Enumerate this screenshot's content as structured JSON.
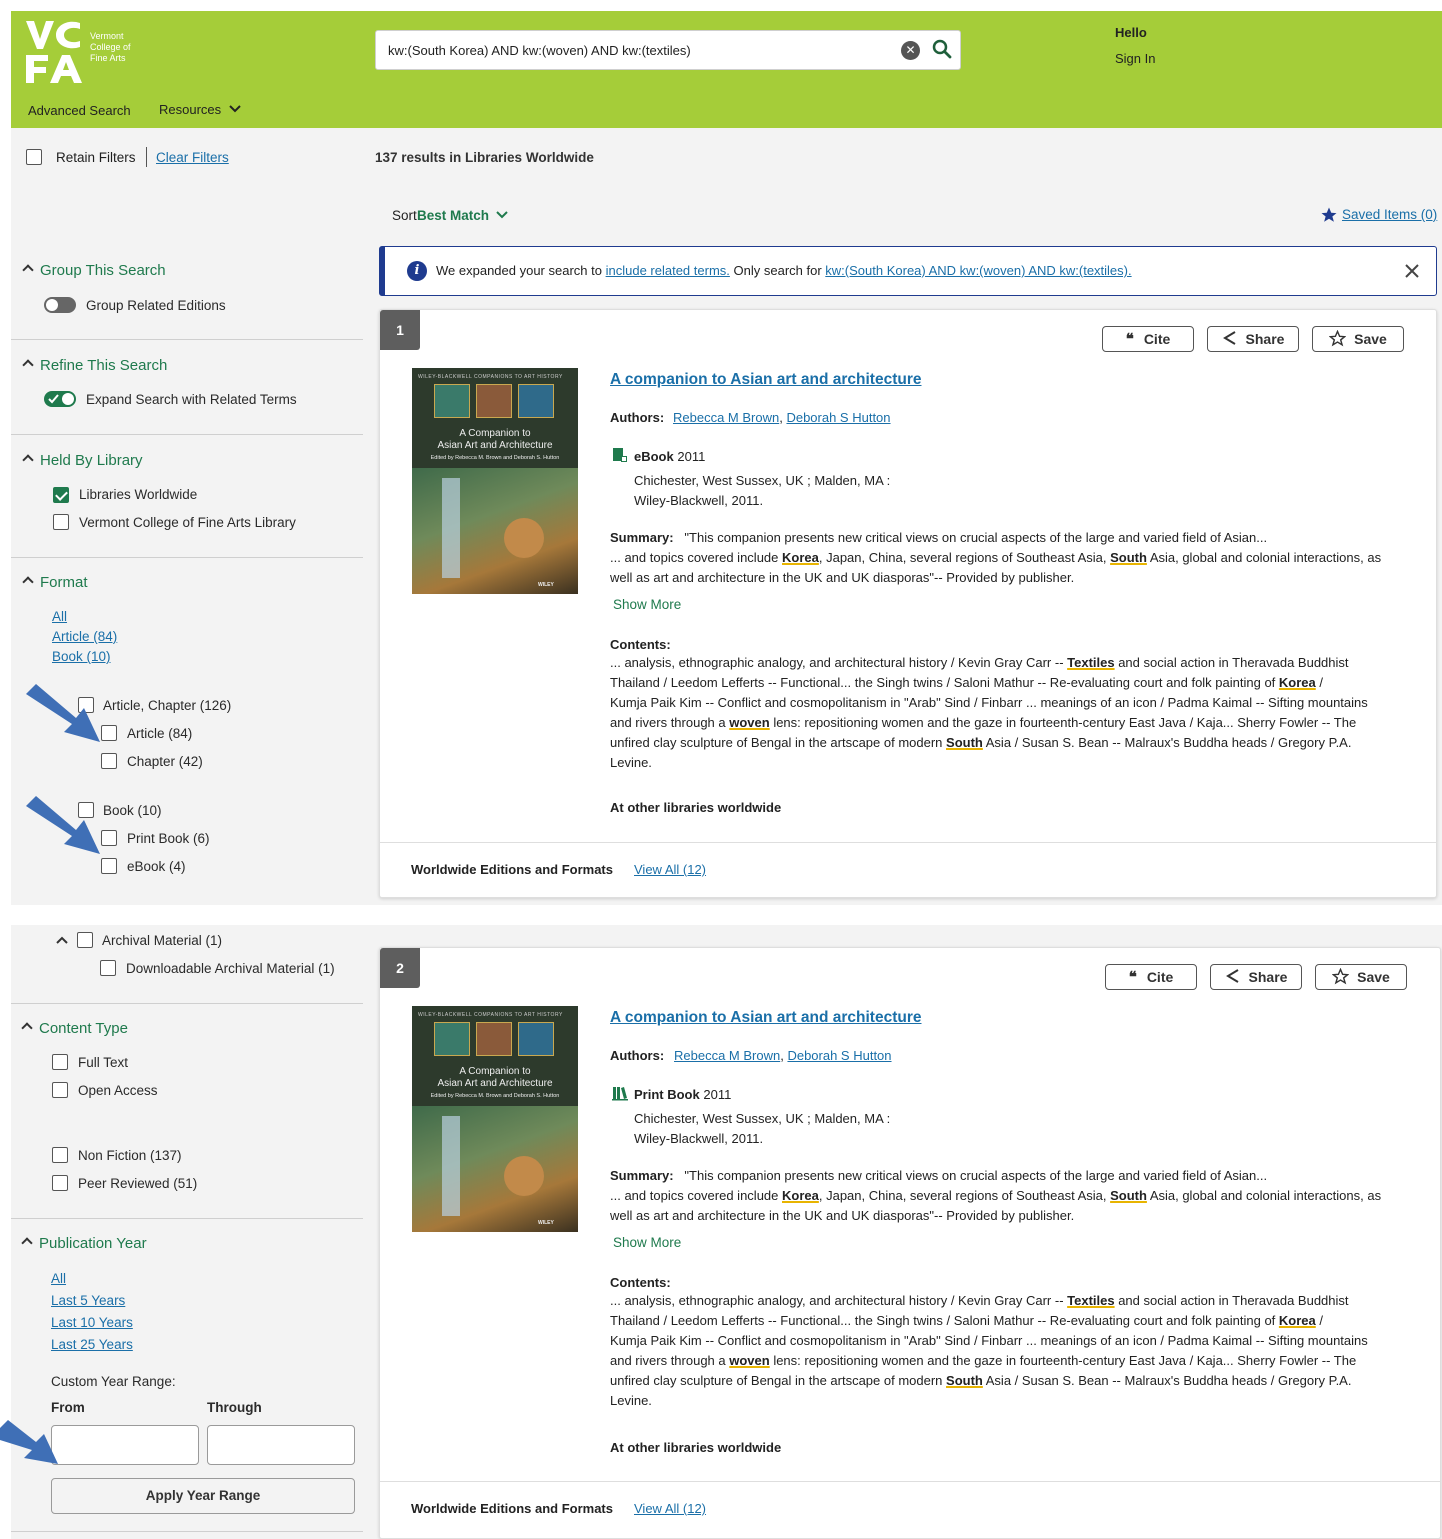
{
  "header": {
    "logo_letters": "VC\nFA",
    "logo_name_1": "Vermont",
    "logo_name_2": "College of",
    "logo_name_3": "Fine Arts",
    "search_value": "kw:(South Korea) AND kw:(woven) AND kw:(textiles)",
    "hello": "Hello",
    "sign_in": "Sign In",
    "advanced_search": "Advanced Search",
    "resources": "Resources"
  },
  "filterbar": {
    "retain_filters": "Retain Filters",
    "clear_filters": "Clear Filters",
    "results": "137 results in Libraries Worldwide"
  },
  "sort": {
    "label": "Sort:",
    "value": "Best Match",
    "saved_items": "Saved Items (0)"
  },
  "banner": {
    "pre": "We expanded your search to",
    "link1": "include related terms.",
    "mid": "Only search for",
    "link2": "kw:(South Korea) AND kw:(woven) AND kw:(textiles)."
  },
  "sidebar": {
    "group_title": "Group This Search",
    "group_related": "Group Related Editions",
    "refine_title": "Refine This Search",
    "expand_related": "Expand Search with Related Terms",
    "held_title": "Held By Library",
    "libraries_worldwide": "Libraries Worldwide",
    "vcfa_library": "Vermont College of Fine Arts Library",
    "format_title": "Format",
    "format_links": [
      "All",
      "Article (84)",
      "Book (10)"
    ],
    "article_chapter": "Article, Chapter (126)",
    "article": "Article (84)",
    "chapter": "Chapter (42)",
    "book": "Book (10)",
    "print_book": "Print Book (6)",
    "ebook": "eBook (4)",
    "archival": "Archival Material (1)",
    "downloadable_archival": "Downloadable Archival Material (1)",
    "content_type_title": "Content Type",
    "full_text": "Full Text",
    "open_access": "Open Access",
    "non_fiction": "Non Fiction (137)",
    "peer_reviewed": "Peer Reviewed (51)",
    "pub_year_title": "Publication Year",
    "year_links": [
      "All",
      "Last 5 Years",
      "Last 10 Years",
      "Last 25 Years"
    ],
    "custom_range": "Custom Year Range:",
    "from": "From",
    "through": "Through",
    "apply": "Apply Year Range"
  },
  "buttons": {
    "cite": "Cite",
    "share": "Share",
    "save": "Save"
  },
  "results": [
    {
      "num": "1",
      "title": "A companion to Asian art and architecture",
      "authors_label": "Authors:",
      "author1": "Rebecca M Brown",
      "author2": "Deborah S Hutton",
      "format": "eBook",
      "year": "2011",
      "pub1": "Chichester, West Sussex, UK ; Malden, MA :",
      "pub2": "Wiley-Blackwell, 2011.",
      "summary_label": "Summary:",
      "show_more": "Show More",
      "contents_label": "Contents:",
      "at_other": "At other libraries worldwide",
      "editions_label": "Worldwide Editions and Formats",
      "view_all": "View All (12)"
    },
    {
      "num": "2",
      "title": "A companion to Asian art and architecture",
      "authors_label": "Authors:",
      "author1": "Rebecca M Brown",
      "author2": "Deborah S Hutton",
      "format": "Print Book",
      "year": "2011",
      "pub1": "Chichester, West Sussex, UK ; Malden, MA :",
      "pub2": "Wiley-Blackwell, 2011.",
      "summary_label": "Summary:",
      "show_more": "Show More",
      "contents_label": "Contents:",
      "at_other": "At other libraries worldwide",
      "editions_label": "Worldwide Editions and Formats",
      "view_all": "View All (12)"
    }
  ],
  "text": {
    "summary_line1": "\"This companion presents new critical views on crucial aspects of the large and varied field of Asian...",
    "sum_a": "... and topics covered include ",
    "sum_korea": "Korea",
    "sum_b": ", Japan, China, several regions of Southeast Asia, ",
    "sum_south": "South",
    "sum_c": " Asia, global and colonial interactions, as",
    "summary_line3": "well as art and architecture in the UK and UK diasporas\"-- Provided by publisher.",
    "c1a": "... analysis, ethnographic analogy, and architectural history / Kevin Gray Carr -- ",
    "c1_textiles": "Textiles",
    "c1b": " and social action in Theravada Buddhist",
    "c2a": "Thailand / Leedom Lefferts -- Functional... the Singh twins / Saloni Mathur -- Re-evaluating court and folk painting of ",
    "c2_korea": "Korea",
    "c2b": " /",
    "c3": "Kumja Paik Kim -- Conflict and cosmopolitanism in \"Arab\" Sind / Finbarr ... meanings of an icon / Padma Kaimal -- Sifting mountains",
    "c4a": "and rivers through a ",
    "c4_woven": "woven",
    "c4b": " lens: repositioning women and the gaze in fourteenth-century East Java / Kaja... Sherry Fowler -- The",
    "c5a": "unfired clay sculpture of Bengal in the artscape of modern ",
    "c5_south": "South",
    "c5b": " Asia / Susan S. Bean -- Malraux's Buddha heads / Gregory P.A.",
    "c6": "Levine."
  },
  "cover": {
    "series": "WILEY-BLACKWELL COMPANIONS TO ART HISTORY",
    "line1": "A Companion to",
    "line2": "Asian Art and Architecture",
    "line3": "Edited by Rebecca M. Brown and Deborah S. Hutton",
    "publisher": "WILEY"
  },
  "colors": {
    "header": "#a5cd39",
    "accent_green": "#1f7a4d",
    "link_blue": "#1a6fa8",
    "banner_border": "#1f3b8f",
    "arrow_blue": "#3f6fb6"
  }
}
